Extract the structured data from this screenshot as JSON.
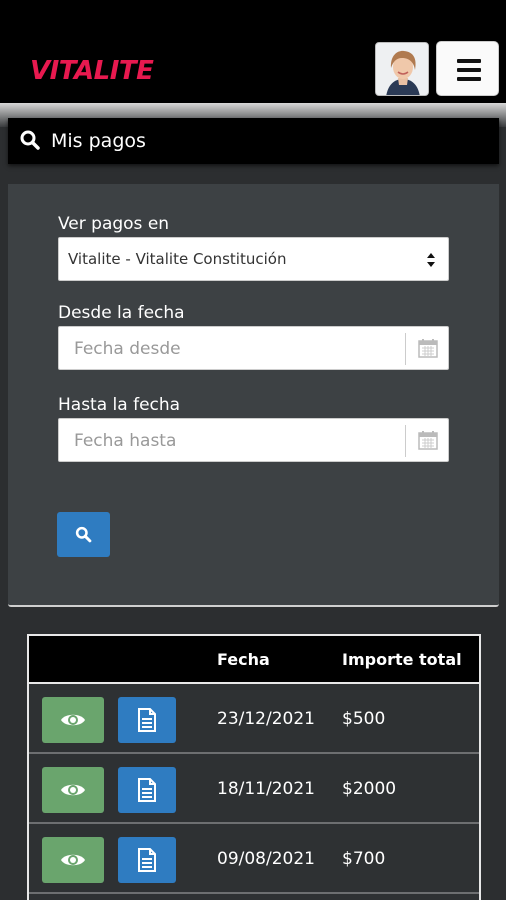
{
  "header": {
    "logo_text": "VITALITE",
    "brand_color": "#e8194f",
    "avatar_icon": "user-photo-avatar",
    "menu_icon": "hamburger-menu-icon"
  },
  "title_bar": {
    "icon": "search-icon",
    "title": "Mis pagos"
  },
  "filters": {
    "club_label": "Ver pagos en",
    "club_value": "Vitalite - Vitalite Constitución",
    "from_label": "Desde la fecha",
    "from_placeholder": "Fecha desde",
    "to_label": "Hasta la fecha",
    "to_placeholder": "Fecha hasta",
    "search_button_icon": "search-icon",
    "accent_color": "#2f7cc1"
  },
  "payments_table": {
    "columns": [
      "",
      "Fecha",
      "Importe total"
    ],
    "rows": [
      {
        "fecha": "23/12/2021",
        "importe": "$500"
      },
      {
        "fecha": "18/11/2021",
        "importe": "$2000"
      },
      {
        "fecha": "09/08/2021",
        "importe": "$700"
      }
    ],
    "view_button_color": "#6aa56d",
    "receipt_button_color": "#2f7cc1"
  }
}
